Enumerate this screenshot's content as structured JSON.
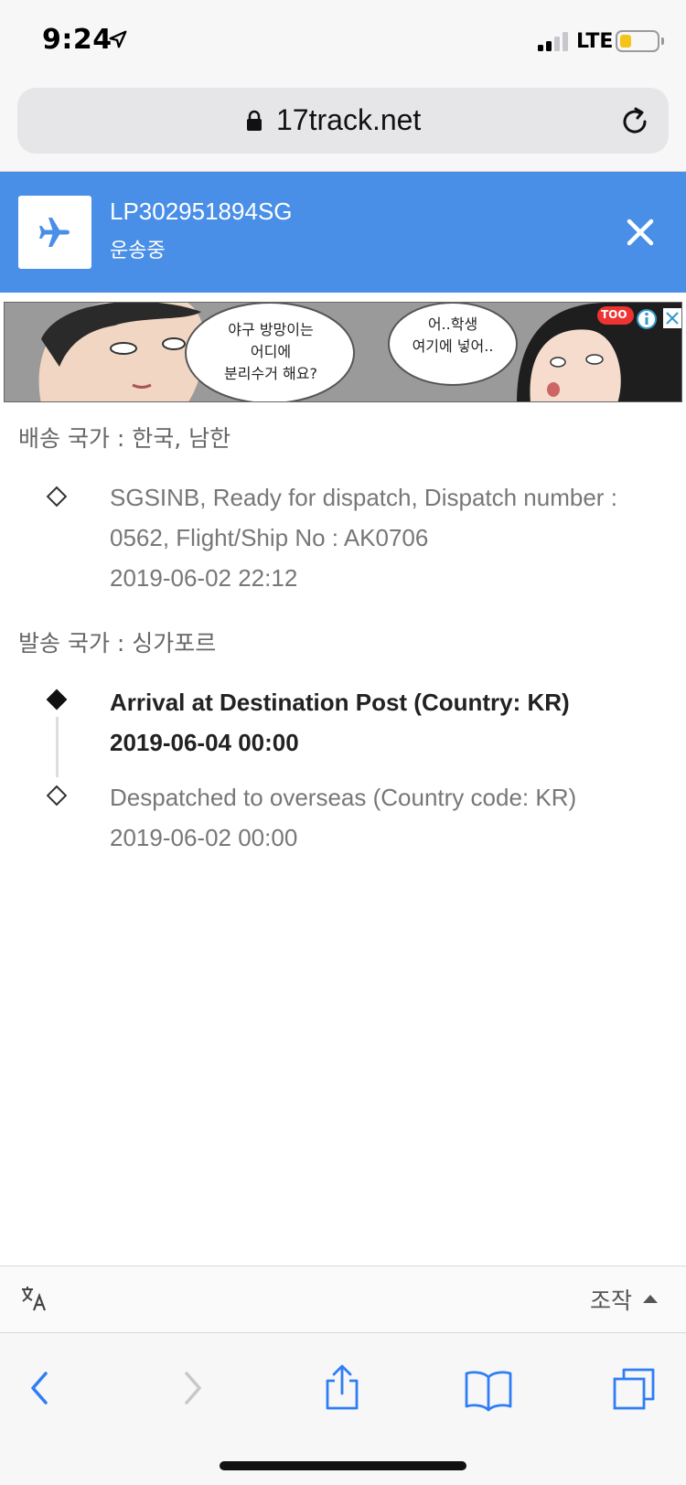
{
  "status_bar": {
    "time": "9:24",
    "network": "LTE",
    "signal_bars_active": 2,
    "signal_bars_total": 4,
    "battery_level": 0.25
  },
  "browser": {
    "address": "17track.net"
  },
  "header": {
    "tracking_number": "LP302951894SG",
    "status": "운송중",
    "accent_color": "#4a8fe7"
  },
  "ad": {
    "bubble1": [
      "야구 방망이는",
      "어디에",
      "분리수거 해요?"
    ],
    "bubble2": [
      "어..학생",
      "여기에 넣어.."
    ],
    "badge": "TOO"
  },
  "destination": {
    "label": "배송 국가 : 한국, 남한",
    "events": [
      {
        "text": "SGSINB, Ready for dispatch, Dispatch number : 0562, Flight/Ship No : AK0706",
        "time": "2019-06-02 22:12"
      }
    ]
  },
  "origin": {
    "label": "발송 국가 : 싱가포르",
    "events": [
      {
        "text": "Arrival at Destination Post (Country: KR)",
        "time": "2019-06-04 00:00"
      },
      {
        "text": "Despatched to overseas (Country code: KR)",
        "time": "2019-06-02 00:00"
      }
    ]
  },
  "reader_bar": {
    "controls_label": "조작"
  },
  "toolbar": {
    "icons": [
      "back-icon",
      "forward-icon",
      "share-icon",
      "bookmarks-icon",
      "tabs-icon"
    ]
  }
}
